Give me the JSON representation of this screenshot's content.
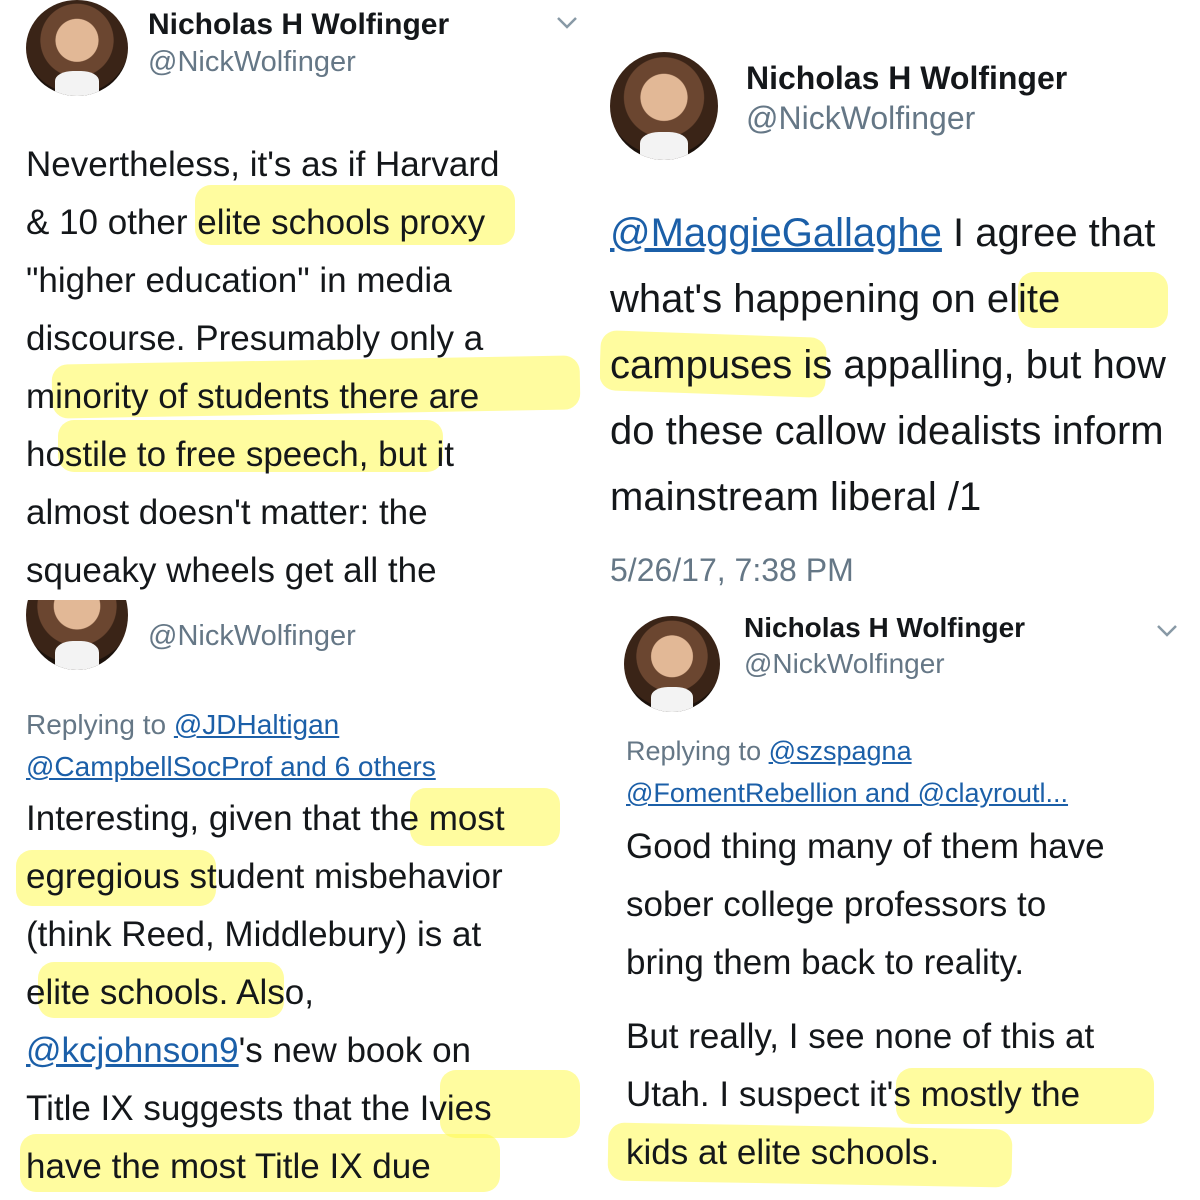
{
  "tweets": {
    "top_left": {
      "name": "Nicholas H Wolfinger",
      "handle": "@NickWolfinger",
      "lines": [
        "Nevertheless, it's as if Harvard",
        "& 10 other elite schools proxy",
        "\"higher education\" in media",
        "discourse. Presumably only a",
        "minority of students there are",
        "hostile to free speech, but it",
        "almost doesn't matter: the",
        "squeaky wheels get all the"
      ]
    },
    "top_right": {
      "name": "Nicholas H Wolfinger",
      "handle": "@NickWolfinger",
      "mention": "@MaggieGallaghe",
      "first_line_rest": " I agree that",
      "lines": [
        "what's happening on elite",
        "campuses is appalling, but how",
        "do these callow idealists inform",
        "mainstream liberal /1"
      ],
      "timestamp": "5/26/17, 7:38 PM"
    },
    "bottom_left": {
      "handle": "@NickWolfinger",
      "replying_label": "Replying to ",
      "replying_user": "@JDHaltigan",
      "replying_others": "@CampbellSocProf and 6 others",
      "lines_a": [
        "Interesting, given that the most",
        "egregious student misbehavior",
        "(think Reed, Middlebury) is at",
        "elite schools. Also,"
      ],
      "mention": "@kcjohnson9",
      "mention_rest": "'s new book on",
      "lines_b": [
        "Title IX suggests that the Ivies",
        "have the most Title IX due"
      ]
    },
    "bottom_right": {
      "name": "Nicholas H Wolfinger",
      "handle": "@NickWolfinger",
      "replying_label": "Replying to ",
      "replying_user": "@szspagna",
      "replying_others": "@FomentRebellion and @clayroutl...",
      "para1": [
        "Good thing many of them have",
        "sober college professors to",
        "bring them back to reality."
      ],
      "para2": [
        "But really, I see none of this at",
        "Utah. I suspect it's mostly the",
        "kids at elite schools."
      ]
    }
  },
  "colors": {
    "highlight": "#fff950",
    "link": "#1b5fa8",
    "secondary_text": "#657786"
  },
  "icons": {
    "menu_chevron": "chevron-down-icon"
  }
}
